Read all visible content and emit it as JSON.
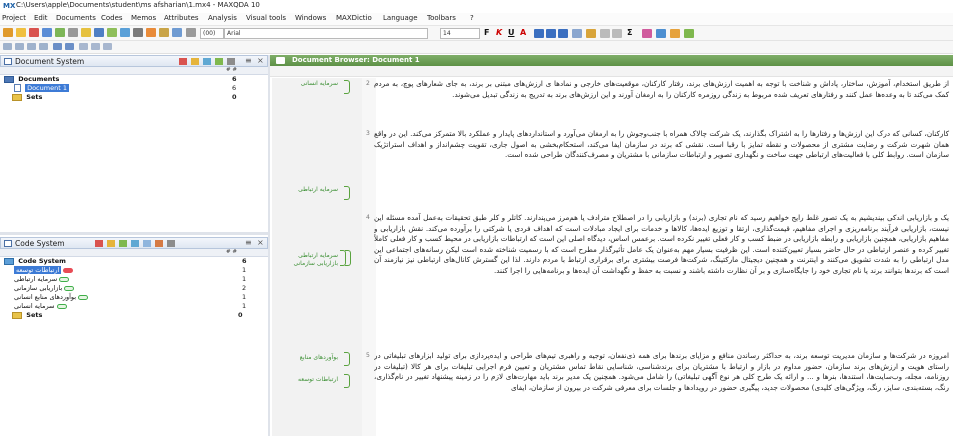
{
  "window": {
    "title": "C:\\Users\\apple\\Documents\\student\\ms afsharian\\1.mx4 - MAXQDA 10",
    "app_icon_text": "MX"
  },
  "menu": [
    "Project",
    "Edit",
    "Documents",
    "Codes",
    "Memos",
    "Attributes",
    "Analysis",
    "Visual tools",
    "Windows",
    "MAXDictio",
    "Language",
    "Toolbars",
    "?"
  ],
  "toolbar": {
    "font_name": "Arial",
    "font_size": "14",
    "bold_label": "F",
    "italic_label": "K",
    "underline_label": "U",
    "color_label": "A",
    "sum_label": "Σ"
  },
  "document_system": {
    "title": "Document System",
    "col_header": "# #",
    "rows": [
      {
        "label": "Documents",
        "count": "6",
        "bold": true
      },
      {
        "label": "Document 1",
        "count": "6",
        "selected": true
      },
      {
        "label": "Sets",
        "count": "0",
        "bold": true
      }
    ]
  },
  "code_system": {
    "title": "Code System",
    "col_header": "# #",
    "rows": [
      {
        "label": "Code System",
        "count": "6",
        "bold": true
      },
      {
        "label": "ارتباطات توسعه",
        "count": "1",
        "selected": true,
        "color": "#e84b55"
      },
      {
        "label": "سرمایه ارتباطی",
        "count": "1",
        "color": "#3fae49"
      },
      {
        "label": "بازاریابی سازمانی",
        "count": "2",
        "color": "#3fae49"
      },
      {
        "label": "بوآوردهای منابع انسانی",
        "count": "1",
        "color": "#3fae49"
      },
      {
        "label": "سرمایه انسانی",
        "count": "1",
        "color": "#3fae49"
      },
      {
        "label": "Sets",
        "count": "0",
        "bold": true
      }
    ]
  },
  "document_browser": {
    "title": "Document Browser: Document 1",
    "paragraphs": [
      {
        "num": "2",
        "text": "از طریق استخدام، آموزش، ساختار، پاداش و شناخت با توجه به اهمیت ارزش‌های برند، رفتار کارکنان، موقعیت‌های خارجی و نمادها ی ارزش‌های مبتنی بر برند، به جای شعارهای پوچ، به مردم کمک می‌کند تا به وعده‌ها عمل کنند و رفتارهای تعریف شده مربوط به زندگی روزمره کارکنان را به ارمغان آورند و این ارزش‌های برند به تدریج به زندگی تبدیل می‌شوند."
      },
      {
        "num": "3",
        "text": "کارکنان، کسانی که درک این ارزش‌ها و رفتارها را به اشتراک بگذارند، یک شرکت چالاک همراه با جنب‌وجوش را به ارمغان می‌آورد و استانداردهای پایدار و عملکرد بالا متمرکز می‌کند. این در واقع همان شهرت شرکت و رضایت مشتری از محصولات و نقطه تمایز با رقبا است. نقشی که برند در سازمان ایفا می‌کند، استحکام‌بخشی به اصول جاری، تقویت چشم‌انداز و اهداف استراتژیک سازمان است. روابط کلی با فعالیت‌های ارتباطی جهت ساخت و نگهداری تصویر و ارتباطات سازمانی با مشتریان و مصرف‌کنندگان طراحی شده است."
      },
      {
        "num": "4",
        "text": "یک و بازاریابی اندکی بیندیشیم به یک تصور غلط رایج خواهیم رسید که نام تجاری (برند) و بازاریابی را در اصطلاح مترادف یا هم‌مرز می‌پندارند. کاتلر و کلر طبق تحقیقات به‌عمل آمده مسئله این نیست، بازاریابی فرآیند برنامه‌ریزی و اجرای مفاهیم، قیمت‌گذاری، ارتقا و توزیع ایده‌ها، کالاها و خدمات برای ایجاد مبادلات است که اهداف فردی یا شرکتی را برآورده می‌کند. نقش بازاریابی و مفاهیم بازاریابی، همچنین بازاریابی و رابطه بازاریابی در ضبط کسب و کار فعلی تغییر نکرده است. برعمس اساس، دیدگاه اصلی این است که ارتباطات بازاریابی در محیط کسب و کار فعلی کاملاً تغییر کرده و عنصر ارتباطی در حال حاضر بسیار تعیین‌کننده است. این ظرفیت بسیار مهم به‌عنوان یک عامل تأثیرگذار مطرح است که با رسمیت شناخته شده است لیکن رسانه‌های اجتماعی این مدل ارتباطی را به شدت تشویق می‌کنند و اینترنت و همچنین دیجیتال مارکتینگ، شرکت‌ها فرصت بیشتری برای برقراری ارتباط با مردم دارند. لذا این گسترش کانال‌های ارتباطی نیز نیازمند آن است که برندها بتوانند برند یا نام تجاری خود را جایگاه‌سازی و بر آن نظارت داشته باشند و نسبت به حفظ و نگهداشت آن ایده‌ها و برنامه‌هایی را اجرا کنند."
      },
      {
        "num": "5",
        "text": "امروزه در شرکت‌ها و سازمان مدیریت توسعه برند، به حداکثر رساندن منافع و مزایای برندها برای همه ذی‌نفعان، توجیه و راهبری تیم‌های طراحی و ایده‌پردازی برای تولید ابزارهای تبلیغاتی در راستای هویت و ارزش‌های برند سازمان، حضور مداوم در بازار و ارتباط با مشتریان برای برندشناسی، شناسایی نقاط تماس مشتریان و تعیین فرم اجرایی تبلیغات برای هر کالا (تبلیغات در روزنامه، مجله، وب‌سایت‌ها، استندها، بنرها و ... و ارائه یک طرح کلی هر نوع آگهی تبلیغاتی) را شامل می‌شود. همچنین یک مدیر برند باید مهارت‌های لازم را در زمینه پیشنهاد تغییر در نام‌گذاری، رنگ، بسته‌بندی، سایز، رنگ، ویژگی‌های کلیدی) محصولات جدید، پیگیری حضور در رویدادها و جلسات برای معرفی شرکت در بیرون از سازمان، ایفای"
      }
    ],
    "code_labels": [
      {
        "id": "c1",
        "text": "سرمایه انسانی"
      },
      {
        "id": "c2",
        "text": "سرمایه ارتباطی"
      },
      {
        "id": "c3",
        "text": "سرمایه ارتباطی"
      },
      {
        "id": "c4",
        "text": "بازاریابی سازمانی"
      },
      {
        "id": "c5",
        "text": "بوآوردهای منابع"
      },
      {
        "id": "c6",
        "text": "ارتباطات توسعه"
      }
    ]
  },
  "colors": {
    "doc_header": "#6fa35a",
    "code_green": "#3fae49",
    "code_red": "#e84b55",
    "selection_blue": "#3d7bd6",
    "panel_border": "#b7c6dc"
  }
}
